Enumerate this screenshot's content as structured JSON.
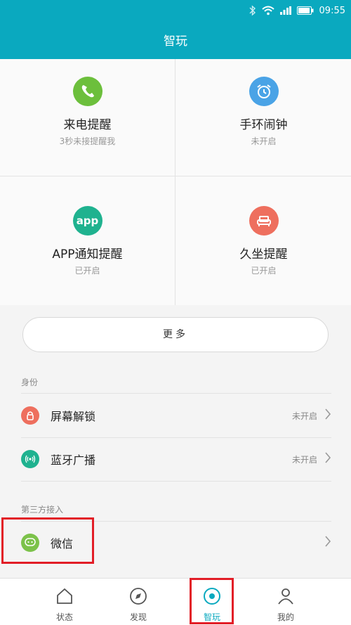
{
  "status_bar": {
    "time": "09:55"
  },
  "header": {
    "title": "智玩"
  },
  "tiles": [
    {
      "label": "来电提醒",
      "sub": "3秒未接提醒我",
      "icon": "phone-icon",
      "color": "#6cbf3c"
    },
    {
      "label": "手环闹钟",
      "sub": "未开启",
      "icon": "alarm-clock-icon",
      "color": "#4aa3e6"
    },
    {
      "label": "APP通知提醒",
      "sub": "已开启",
      "icon": "app-icon",
      "icon_text": "app",
      "color": "#1fb28f"
    },
    {
      "label": "久坐提醒",
      "sub": "已开启",
      "icon": "sofa-icon",
      "color": "#ee6f5e"
    }
  ],
  "more_button": {
    "label": "更多"
  },
  "identity": {
    "title": "身份",
    "rows": [
      {
        "label": "屏幕解锁",
        "status": "未开启",
        "icon": "lock-icon",
        "color": "#ee6f5e"
      },
      {
        "label": "蓝牙广播",
        "status": "未开启",
        "icon": "broadcast-icon",
        "color": "#1fb28f"
      }
    ]
  },
  "third_party": {
    "title": "第三方接入",
    "rows": [
      {
        "label": "微信",
        "icon": "wechat-icon",
        "color": "#7cc24a"
      }
    ]
  },
  "bottom_nav": [
    {
      "label": "状态",
      "icon": "home-icon"
    },
    {
      "label": "发现",
      "icon": "compass-icon"
    },
    {
      "label": "智玩",
      "icon": "target-icon",
      "active": true
    },
    {
      "label": "我的",
      "icon": "person-icon"
    }
  ],
  "colors": {
    "accent": "#0aa9bf",
    "highlight": "#e21e27"
  }
}
